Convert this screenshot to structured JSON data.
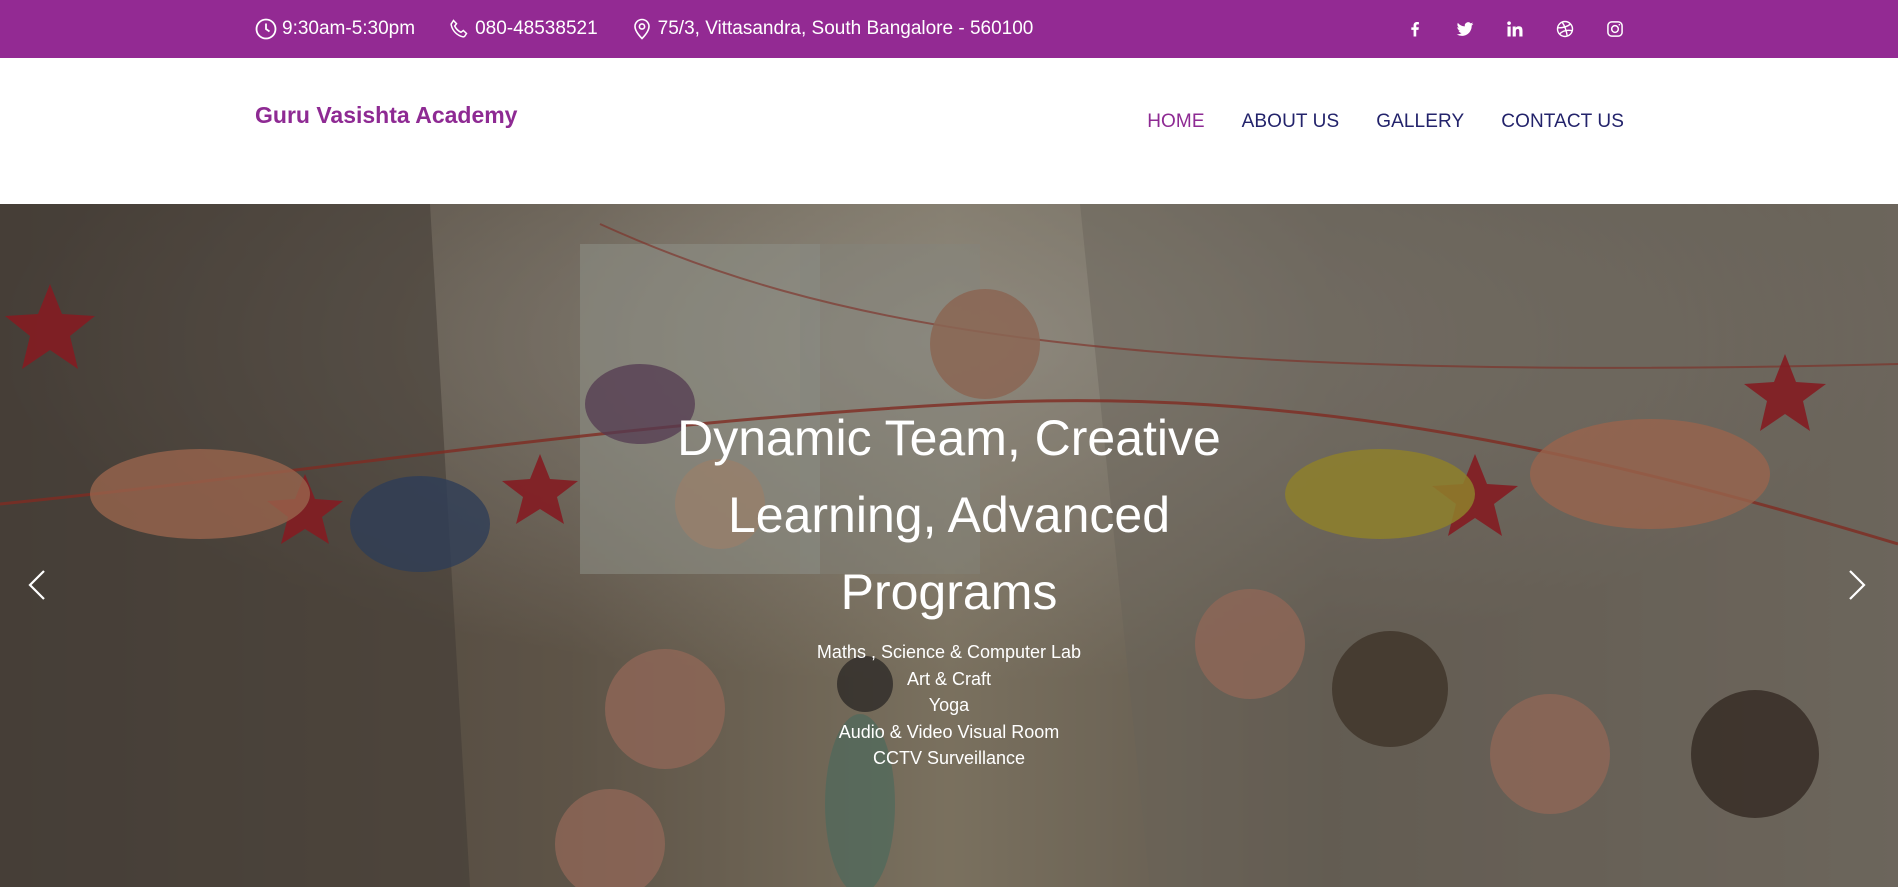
{
  "topbar": {
    "hours": "9:30am-5:30pm",
    "phone": "080-48538521",
    "address": "75/3, Vittasandra, South Bangalore - 560100",
    "social": [
      {
        "name": "facebook-icon"
      },
      {
        "name": "twitter-icon"
      },
      {
        "name": "linkedin-icon"
      },
      {
        "name": "dribbble-icon"
      },
      {
        "name": "instagram-icon"
      }
    ],
    "background_color": "#932a93"
  },
  "header": {
    "brand": "Guru Vasishta Academy",
    "nav": [
      {
        "label": "HOME",
        "active": true
      },
      {
        "label": "ABOUT US",
        "active": false
      },
      {
        "label": "GALLERY",
        "active": false
      },
      {
        "label": "CONTACT US",
        "active": false
      }
    ],
    "brand_color": "#8e2a93",
    "nav_color": "#23236b"
  },
  "hero": {
    "title_lines": [
      "Dynamic Team, Creative",
      "Learning, Advanced",
      "Programs"
    ],
    "features": [
      "Maths , Science & Computer Lab",
      "Art & Craft",
      "Yoga",
      "Audio & Video Visual Room",
      "CCTV Surveillance"
    ],
    "prev_icon": "chevron-left-icon",
    "next_icon": "chevron-right-icon"
  }
}
